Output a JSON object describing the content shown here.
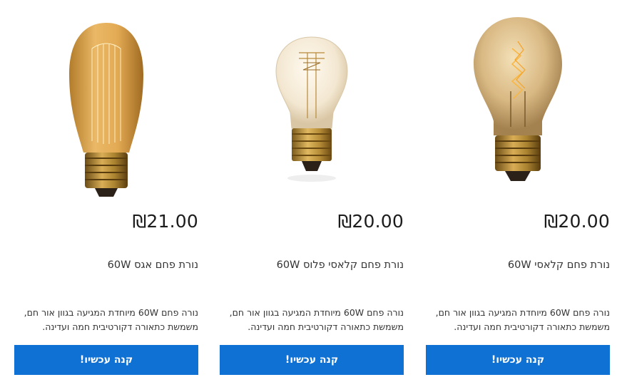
{
  "products": [
    {
      "price": "₪20.00",
      "title": "נורת פחם קלאסי 60W",
      "description": "נורה פחם 60W מיוחדת המגיעה בגוון אור חם, משמשת כתאורה דקורטיבית חמה ועדינה.",
      "button_label": "קנה עכשיו!",
      "image_icon": "vintage-bulb-a19-amber"
    },
    {
      "price": "₪20.00",
      "title": "נורת פחם קלאסי פלוס 60W",
      "description": "נורה פחם 60W מיוחדת המגיעה בגוון אור חם, משמשת כתאורה דקורטיבית חמה ועדינה.",
      "button_label": "קנה עכשיו!",
      "image_icon": "vintage-bulb-clear"
    },
    {
      "price": "₪21.00",
      "title": "נורת פחם אגס 60W",
      "description": "נורה פחם 60W מיוחדת המגיעה בגוון אור חם, משמשת כתאורה דקורטיבית חמה ועדינה.",
      "button_label": "קנה עכשיו!",
      "image_icon": "vintage-bulb-st64-amber"
    }
  ],
  "colors": {
    "button_bg": "#0f71d3",
    "button_text": "#ffffff",
    "text": "#333333"
  }
}
